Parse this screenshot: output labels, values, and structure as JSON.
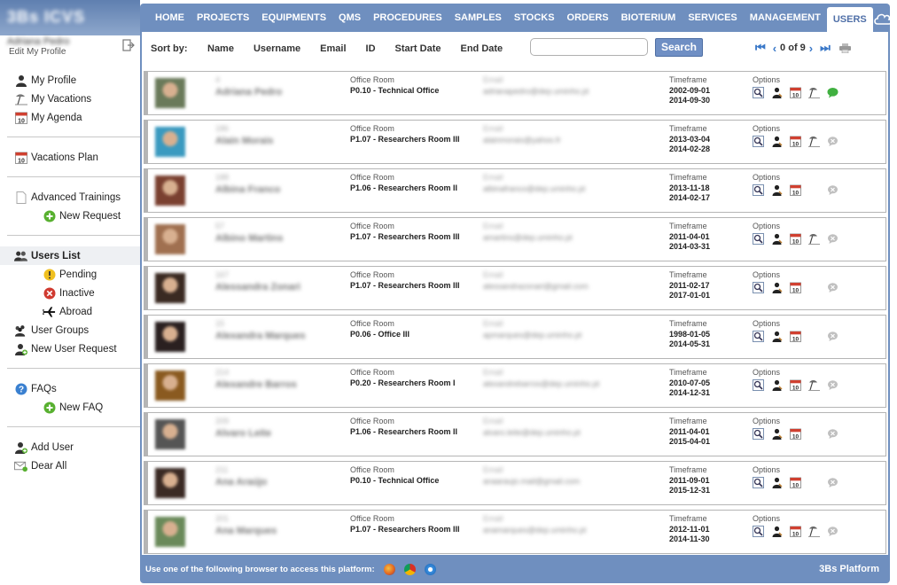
{
  "app": {
    "logo": "3Bs ICVS",
    "user_name": "Adriana Pedro",
    "edit_profile": "Edit My Profile"
  },
  "sidebar": {
    "group1": [
      {
        "label": "My Profile",
        "icon": "user-icon"
      },
      {
        "label": "My Vacations",
        "icon": "vacation-icon"
      },
      {
        "label": "My Agenda",
        "icon": "calendar-icon"
      }
    ],
    "group2": [
      {
        "label": "Vacations Plan",
        "icon": "calendar-icon"
      }
    ],
    "group3": [
      {
        "label": "Advanced Trainings",
        "icon": "document-icon"
      },
      {
        "label": "New Request",
        "icon": "add-icon"
      }
    ],
    "group4": [
      {
        "label": "Users List",
        "icon": "users-icon",
        "active": true
      },
      {
        "label": "Pending",
        "icon": "warning-icon"
      },
      {
        "label": "Inactive",
        "icon": "inactive-icon"
      },
      {
        "label": "Abroad",
        "icon": "plane-icon"
      },
      {
        "label": "User Groups",
        "icon": "user-groups-icon"
      },
      {
        "label": "New User Request",
        "icon": "add-user-icon"
      }
    ],
    "group5": [
      {
        "label": "FAQs",
        "icon": "help-icon"
      },
      {
        "label": "New FAQ",
        "icon": "add-icon"
      }
    ],
    "group6": [
      {
        "label": "Add User",
        "icon": "add-user-icon"
      },
      {
        "label": "Dear All",
        "icon": "mail-icon"
      }
    ]
  },
  "nav": {
    "items": [
      "HOME",
      "PROJECTS",
      "EQUIPMENTS",
      "QMS",
      "PROCEDURES",
      "SAMPLES",
      "STOCKS",
      "ORDERS",
      "BIOTERIUM",
      "SERVICES",
      "MANAGEMENT",
      "USERS"
    ],
    "active": "USERS",
    "qr": "QR"
  },
  "sortbar": {
    "label": "Sort by:",
    "options": [
      "Name",
      "Username",
      "Email",
      "ID",
      "Start Date",
      "End Date"
    ],
    "search_placeholder": "",
    "search_button": "Search",
    "page_info": "0 of 9"
  },
  "labels": {
    "office_room": "Office Room",
    "timeframe": "Timeframe",
    "options": "Options",
    "email": "Email"
  },
  "rows": [
    {
      "id": "4",
      "name": "Adriana Pedro",
      "room": "P0.10 - Technical Office",
      "email": "adrianapedro@dep.uminho.pt",
      "start": "2002-09-01",
      "end": "2014-09-30",
      "avatar": "#6a7a5a",
      "abroad": true,
      "chat": "online"
    },
    {
      "id": "186",
      "name": "Alain Morais",
      "room": "P1.07 - Researchers Room III",
      "email": "alainmorais@yahoo.fr",
      "start": "2013-03-04",
      "end": "2014-02-28",
      "avatar": "#3a9ac0",
      "abroad": true,
      "chat": "offline"
    },
    {
      "id": "188",
      "name": "Albina Franco",
      "room": "P1.06 - Researchers Room II",
      "email": "albinafranco@dep.uminho.pt",
      "start": "2013-11-18",
      "end": "2014-02-17",
      "avatar": "#7a4030",
      "abroad": false,
      "chat": "offline"
    },
    {
      "id": "57",
      "name": "Albino Martins",
      "room": "P1.07 - Researchers Room III",
      "email": "amartins@dep.uminho.pt",
      "start": "2011-04-01",
      "end": "2014-03-31",
      "avatar": "#a07050",
      "abroad": true,
      "chat": "offline"
    },
    {
      "id": "167",
      "name": "Alessandra Zonari",
      "room": "P1.07 - Researchers Room III",
      "email": "alessandrazonari@gmail.com",
      "start": "2011-02-17",
      "end": "2017-01-01",
      "avatar": "#3a2a22",
      "abroad": false,
      "chat": "offline"
    },
    {
      "id": "15",
      "name": "Alexandra Marques",
      "room": "P0.06 - Office III",
      "email": "apmarques@dep.uminho.pt",
      "start": "1998-01-05",
      "end": "2014-05-31",
      "avatar": "#2a2020",
      "abroad": false,
      "chat": "offline"
    },
    {
      "id": "214",
      "name": "Alexandre Barros",
      "room": "P0.20 - Researchers Room I",
      "email": "alexandrebarros@dep.uminho.pt",
      "start": "2010-07-05",
      "end": "2014-12-31",
      "avatar": "#8a5a20",
      "abroad": true,
      "chat": "offline"
    },
    {
      "id": "209",
      "name": "Alvaro Leite",
      "room": "P1.06 - Researchers Room II",
      "email": "alvaro.leite@dep.uminho.pt",
      "start": "2011-04-01",
      "end": "2015-04-01",
      "avatar": "#555555",
      "abroad": false,
      "chat": "offline"
    },
    {
      "id": "211",
      "name": "Ana Araújo",
      "room": "P0.10 - Technical Office",
      "email": "anaaraujo.mail@gmail.com",
      "start": "2011-09-01",
      "end": "2015-12-31",
      "avatar": "#3a2a24",
      "abroad": false,
      "chat": "offline"
    },
    {
      "id": "201",
      "name": "Ana Marques",
      "room": "P1.07 - Researchers Room III",
      "email": "anamarques@dep.uminho.pt",
      "start": "2012-11-01",
      "end": "2014-11-30",
      "avatar": "#6a8a5a",
      "abroad": true,
      "chat": "offline"
    }
  ],
  "footer": {
    "text": "Use one of the following browser to access this platform:",
    "browsers": [
      "firefox-icon",
      "chrome-icon",
      "safari-icon"
    ],
    "platform": "3Bs Platform"
  },
  "colors": {
    "nav_bg": "#6f8fbf",
    "accent": "#3a78c8",
    "search_btn": "#6f8fc4",
    "row_border": "#b5b5b5"
  }
}
